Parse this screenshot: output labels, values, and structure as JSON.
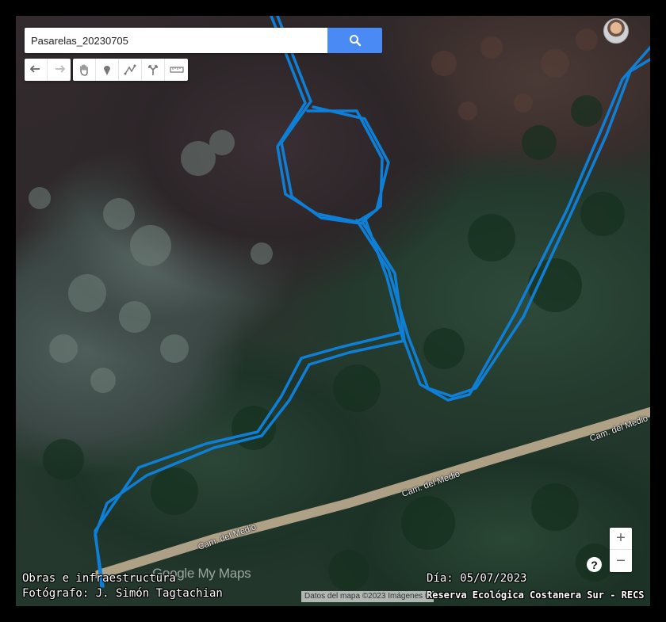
{
  "search": {
    "value": "Pasarelas_20230705",
    "button_icon": "search-icon"
  },
  "toolbar": {
    "buttons": [
      "undo-icon",
      "redo-icon",
      "hand-icon",
      "marker-icon",
      "draw-line-icon",
      "directions-icon",
      "ruler-icon"
    ]
  },
  "map": {
    "road_labels": [
      "Cam. del Medio",
      "Cam. del Medio",
      "Cam. del Medio"
    ],
    "brand": "Google My Maps",
    "attribution": "Datos del mapa ©2023 Imágenes ©",
    "track_color": "#0f7fd6"
  },
  "zoom": {
    "in": "+",
    "out": "−"
  },
  "help": "?",
  "captions": {
    "category": "Obras e infraestructura",
    "photographer": "Fotógrafo: J. Simón Tagtachian",
    "date": "Día: 05/07/2023",
    "credit": "Reserva Ecológica Costanera Sur - RECS"
  }
}
